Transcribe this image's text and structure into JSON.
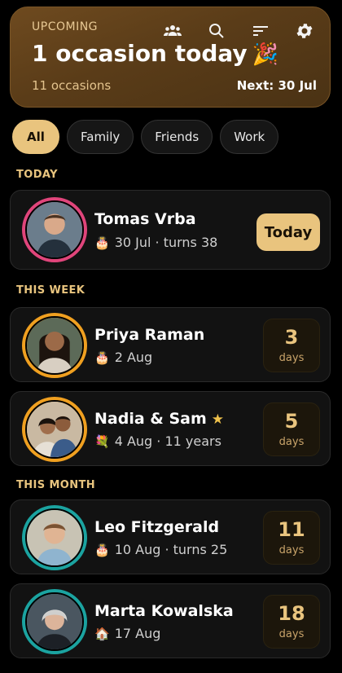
{
  "header": {
    "eyebrow": "UPCOMING",
    "title": "1 occasion today",
    "title_emoji": "🎉",
    "count": "11 occasions",
    "next": "Next: 30 Jul",
    "icons": [
      "people-icon",
      "search-icon",
      "sort-icon",
      "gear-icon"
    ]
  },
  "filters": [
    "All",
    "Family",
    "Friends",
    "Work"
  ],
  "active_filter": "All",
  "sections": {
    "today": "TODAY",
    "week": "THIS WEEK",
    "month": "THIS MONTH"
  },
  "cards": [
    {
      "name": "Tomas Vrba",
      "icon": "🎂",
      "meta": "30 Jul · turns 38",
      "action": "Today",
      "ring": "#e0457b"
    },
    {
      "name": "Priya Raman",
      "icon": "🎂",
      "meta": "2 Aug",
      "days": "3",
      "days_label": "days",
      "ring": "#f0a020"
    },
    {
      "name": "Nadia & Sam",
      "star": "★",
      "icon": "💐",
      "meta": "4 Aug · 11 years",
      "days": "5",
      "days_label": "days",
      "ring": "#f0a020"
    },
    {
      "name": "Leo Fitzgerald",
      "icon": "🎂",
      "meta": "10 Aug · turns 25",
      "days": "11",
      "days_label": "days",
      "ring": "#1ba3a0"
    },
    {
      "name": "Marta Kowalska",
      "icon": "🏠",
      "meta": "17 Aug",
      "days": "18",
      "days_label": "days",
      "ring": "#1ba3a0"
    }
  ],
  "colors": {
    "accent": "#e9c47e",
    "header_bg": "#5a3c18"
  }
}
